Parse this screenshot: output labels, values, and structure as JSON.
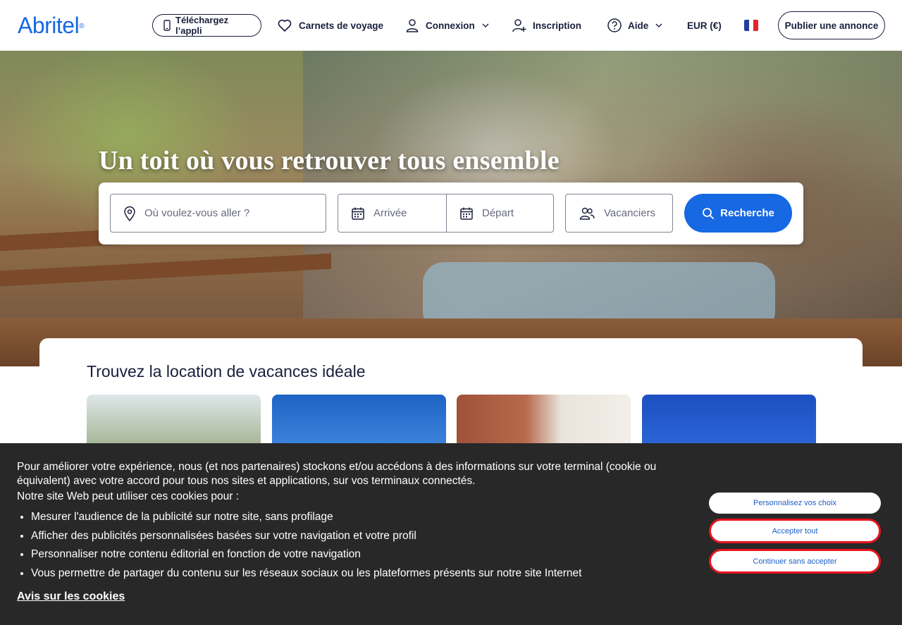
{
  "header": {
    "logo": "Abritel",
    "logo_mark": "®",
    "app_button": "Téléchargez l’appli",
    "trips": "Carnets de voyage",
    "login": "Connexion",
    "signup": "Inscription",
    "help": "Aide",
    "currency": "EUR (€)",
    "language_flag": "fr-flag",
    "publish": "Publier une annonce"
  },
  "hero": {
    "title": "Un toit où vous retrouver tous ensemble"
  },
  "search": {
    "destination_placeholder": "Où voulez-vous aller ?",
    "checkin_placeholder": "Arrivée",
    "checkout_placeholder": "Départ",
    "guests_placeholder": "Vacanciers",
    "button": "Recherche"
  },
  "section": {
    "title": "Trouvez la location de vacances idéale"
  },
  "cookie": {
    "intro": "Pour améliorer votre expérience, nous (et nos partenaires) stockons et/ou accédons à des informations sur votre terminal (cookie ou équivalent) avec votre accord pour tous nos sites et applications, sur vos terminaux connectés.",
    "subtitle": "Notre site Web peut utiliser ces cookies pour :",
    "purposes": [
      "Mesurer l'audience de la publicité sur notre site, sans profilage",
      "Afficher des publicités personnalisées basées sur votre navigation et votre profil",
      "Personnaliser notre contenu éditorial en fonction de votre navigation",
      "Vous permettre de partager du contenu sur les réseaux sociaux ou les plateformes présents sur notre site Internet"
    ],
    "notice_link": "Avis sur les cookies",
    "customize": "Personnalisez vos choix",
    "accept_all": "Accepter tout",
    "continue_without": "Continuer sans accepter"
  },
  "colors": {
    "brand_blue": "#1668e3",
    "text_dark": "#191e3b",
    "cookie_bg": "#282828",
    "highlight_red": "#e8141f"
  }
}
